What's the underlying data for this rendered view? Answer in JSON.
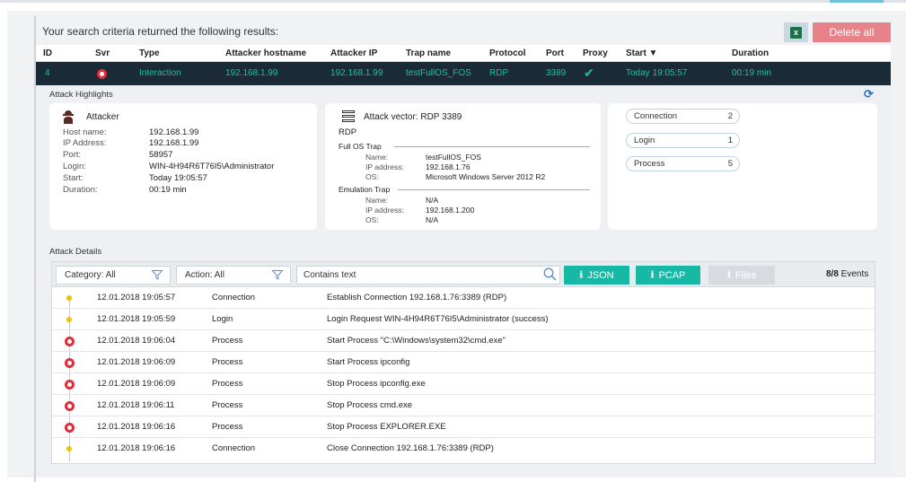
{
  "results_title": "Your search criteria returned the following results:",
  "toolbar": {
    "excel_icon": "excel-icon",
    "delete_all_label": "Delete all"
  },
  "columns": [
    "ID",
    "Svr",
    "Type",
    "Attacker hostname",
    "Attacker IP",
    "Trap name",
    "Protocol",
    "Port",
    "Proxy",
    "Start ▼",
    "Duration"
  ],
  "selected_row": {
    "id": "4",
    "svr_icon": "severity-high-icon",
    "type": "Interaction",
    "attacker_hostname": "192.168.1.99",
    "attacker_ip": "192.168.1.99",
    "trap_name": "testFullOS_FOS",
    "protocol": "RDP",
    "port": "3389",
    "proxy": "✔",
    "start": "Today 19:05:57",
    "duration": "00:19 min"
  },
  "highlights": {
    "title": "Attack Highlights",
    "attacker": {
      "heading": "Attacker",
      "fields": [
        {
          "label": "Host name:",
          "value": "192.168.1.99"
        },
        {
          "label": "IP Address:",
          "value": "192.168.1.99"
        },
        {
          "label": "Port:",
          "value": "58957"
        },
        {
          "label": "Login:",
          "value": "WIN-4H94R6T76I5\\Administrator"
        },
        {
          "label": "Start:",
          "value": "Today 19:05:57"
        },
        {
          "label": "Duration:",
          "value": "00:19 min"
        }
      ]
    },
    "vector": {
      "heading": "Attack vector: RDP 3389",
      "protocol": "RDP",
      "full_os_title": "Full OS Trap",
      "full_os": [
        {
          "label": "Name:",
          "value": "testFullOS_FOS"
        },
        {
          "label": "IP address:",
          "value": "192.168.1.76"
        },
        {
          "label": "OS:",
          "value": "Microsoft Windows Server 2012 R2"
        }
      ],
      "emulation_title": "Emulation Trap",
      "emulation": [
        {
          "label": "Name:",
          "value": "N/A"
        },
        {
          "label": "IP address:",
          "value": "192.168.1.200"
        },
        {
          "label": "OS:",
          "value": "N/A"
        }
      ]
    },
    "counts": [
      {
        "label": "Connection",
        "count": "2"
      },
      {
        "label": "Login",
        "count": "1"
      },
      {
        "label": "Process",
        "count": "5"
      }
    ]
  },
  "details": {
    "title": "Attack Details",
    "category_filter": "Category: All",
    "action_filter": "Action: All",
    "search_placeholder": "Contains text",
    "json_label": "JSON",
    "pcap_label": "PCAP",
    "files_label": "Files",
    "events_bold": "8/8",
    "events_suffix": " Events",
    "events": [
      {
        "severity": "low",
        "time": "12.01.2018 19:05:57",
        "action": "Connection",
        "description": "Establish Connection 192.168.1.76:3389 (RDP)"
      },
      {
        "severity": "low",
        "time": "12.01.2018 19:05:59",
        "action": "Login",
        "description": "Login Request WIN-4H94R6T76I5\\Administrator (success)"
      },
      {
        "severity": "high",
        "time": "12.01.2018 19:06:04",
        "action": "Process",
        "description": "Start Process \"C:\\Windows\\system32\\cmd.exe\""
      },
      {
        "severity": "high",
        "time": "12.01.2018 19:06:09",
        "action": "Process",
        "description": "Start Process ipconfig"
      },
      {
        "severity": "high",
        "time": "12.01.2018 19:06:09",
        "action": "Process",
        "description": "Stop Process ipconfig.exe"
      },
      {
        "severity": "high",
        "time": "12.01.2018 19:06:11",
        "action": "Process",
        "description": "Stop Process cmd.exe"
      },
      {
        "severity": "high",
        "time": "12.01.2018 19:06:16",
        "action": "Process",
        "description": "Stop Process EXPLORER.EXE"
      },
      {
        "severity": "low",
        "time": "12.01.2018 19:06:16",
        "action": "Connection",
        "description": "Close Connection 192.168.1.76:3389 (RDP)"
      }
    ]
  },
  "colors": {
    "accent_teal": "#17b8a6",
    "row_dark": "#1a2a36",
    "delete_red": "#e8828a",
    "severity_high": "#e22d3c",
    "severity_low": "#f2c200"
  }
}
